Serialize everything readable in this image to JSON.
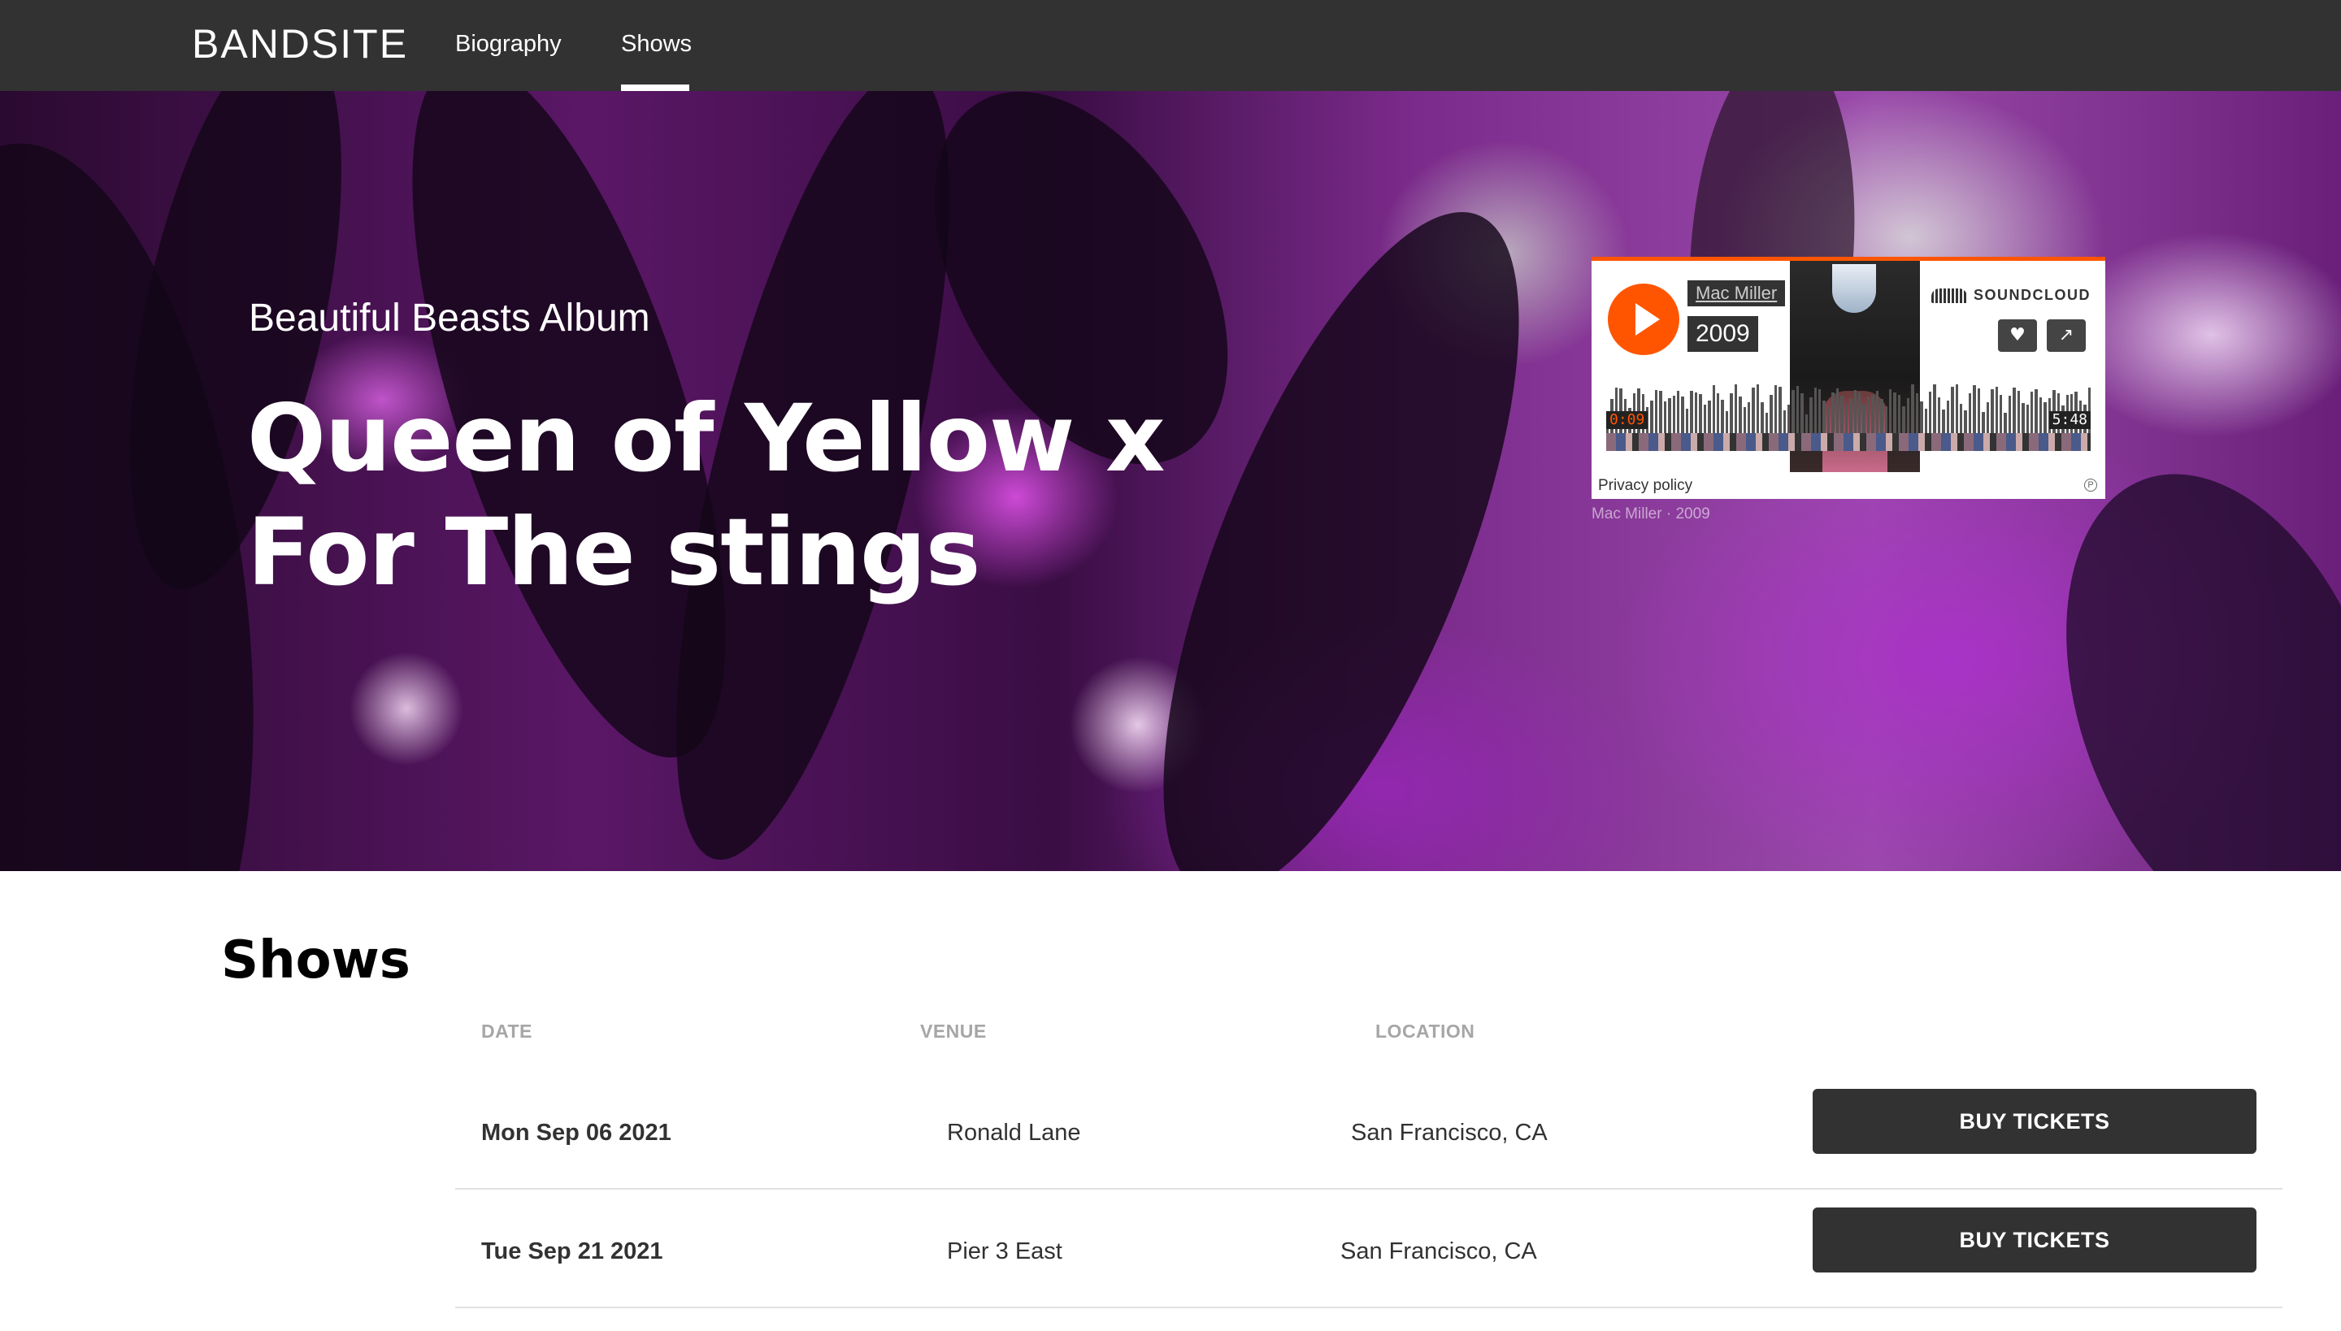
{
  "nav": {
    "brand": "BANDSITE",
    "links": [
      {
        "label": "Biography",
        "active": false
      },
      {
        "label": "Shows",
        "active": true
      }
    ]
  },
  "hero": {
    "subtitle": "Beautiful Beasts Album",
    "title": "Queen of Yellow x For The stings",
    "player": {
      "artist": "Mac Miller",
      "track": "2009",
      "provider": "SOUNDCLOUD",
      "elapsed": "0:09",
      "duration": "5:48",
      "privacy_label": "Privacy policy",
      "caption": "Mac Miller · 2009",
      "accent_color": "#ff5500",
      "like_icon": "heart-icon",
      "share_icon": "share-icon"
    }
  },
  "shows": {
    "title": "Shows",
    "columns": {
      "date": "DATE",
      "venue": "VENUE",
      "location": "LOCATION"
    },
    "rows": [
      {
        "date": "Mon Sep 06 2021",
        "venue": "Ronald Lane",
        "location": "San Francisco, CA",
        "action": "BUY TICKETS"
      },
      {
        "date": "Tue Sep 21 2021",
        "venue": "Pier 3 East",
        "location": "San Francisco, CA",
        "action": "BUY TICKETS"
      }
    ]
  },
  "colors": {
    "nav_bg": "#323232",
    "button_bg": "#323232",
    "header_text": "#a6a6a6"
  }
}
